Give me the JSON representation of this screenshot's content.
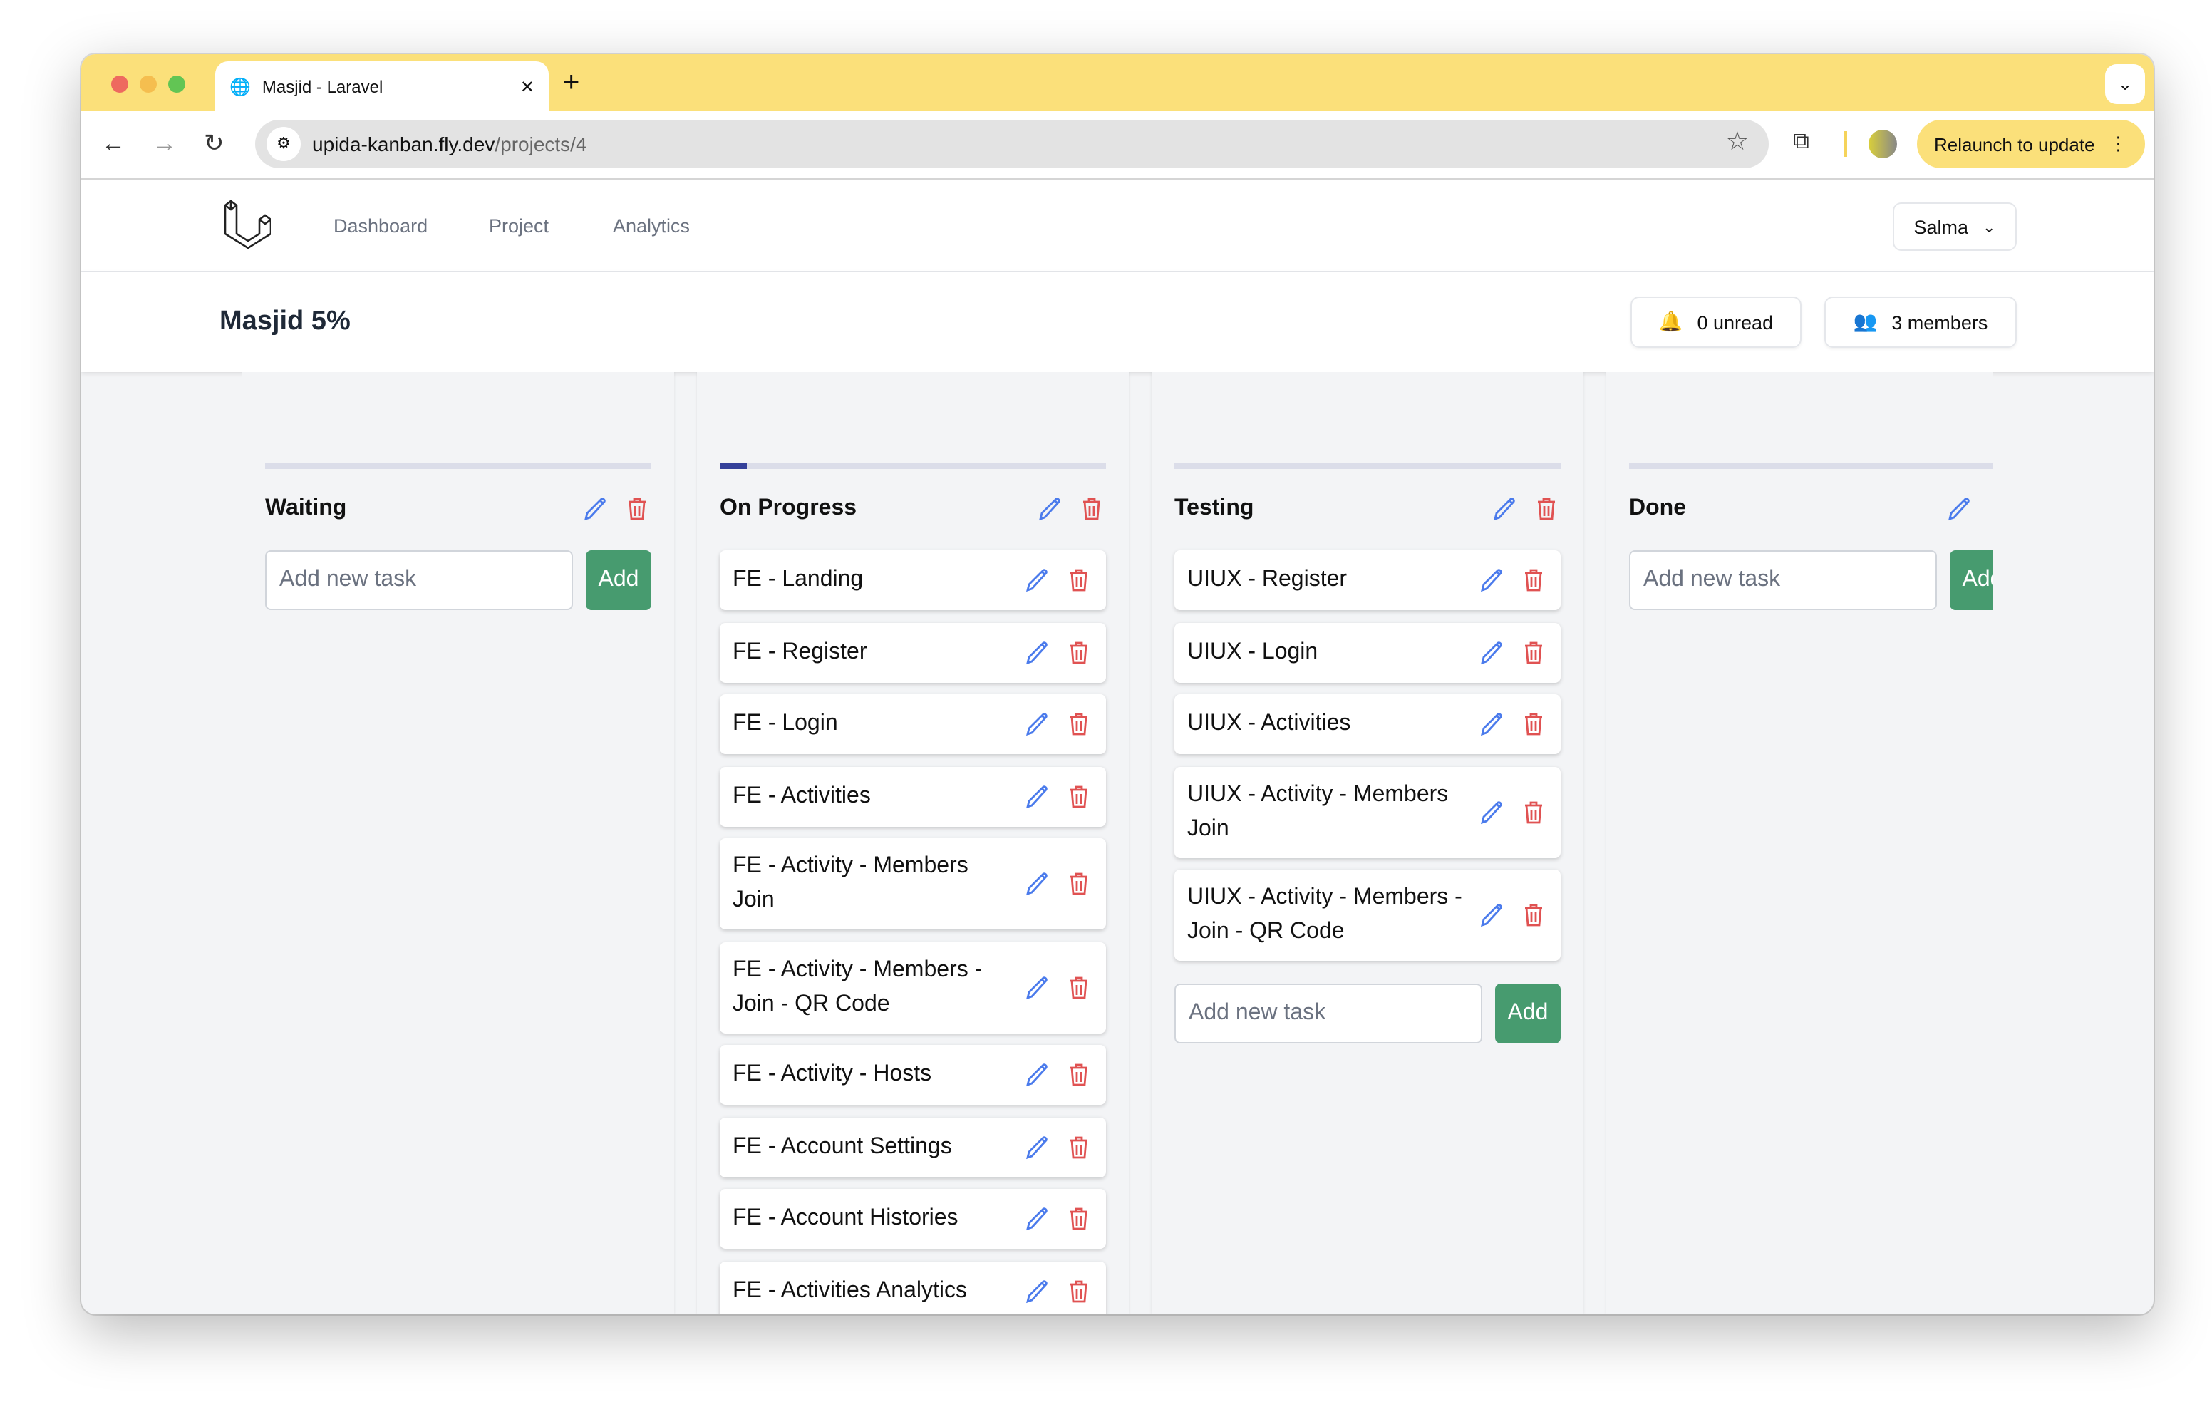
{
  "browser": {
    "tab_title": "Masjid - Laravel",
    "url_host": "upida-kanban.fly.dev",
    "url_path": "/projects/4",
    "relaunch_label": "Relaunch to update"
  },
  "nav": {
    "links": [
      "Dashboard",
      "Project",
      "Analytics"
    ],
    "user": "Salma"
  },
  "project": {
    "title": "Masjid 5%",
    "unread_label": "0 unread",
    "members_label": "3 members"
  },
  "colors": {
    "accent_green": "#479b6f",
    "edit_blue": "#4b7bec",
    "delete_red": "#e05252",
    "progress": "#34409a",
    "tab_bar": "#fbe07a"
  },
  "add_placeholder": "Add new task",
  "add_label": "Add",
  "columns": [
    {
      "name": "Waiting",
      "progress": 0,
      "tasks": []
    },
    {
      "name": "On Progress",
      "progress": 7,
      "tasks": [
        "FE - Landing",
        "FE - Register",
        "FE - Login",
        "FE - Activities",
        "FE - Activity - Members Join",
        "FE - Activity - Members - Join - QR Code",
        "FE - Activity - Hosts",
        "FE - Account Settings",
        "FE - Account Histories",
        "FE - Activities Analytics"
      ]
    },
    {
      "name": "Testing",
      "progress": 0,
      "tasks": [
        "UIUX - Register",
        "UIUX - Login",
        "UIUX - Activities",
        "UIUX - Activity - Members Join",
        "UIUX - Activity - Members - Join - QR Code"
      ]
    },
    {
      "name": "Done",
      "progress": 0,
      "tasks": []
    }
  ]
}
